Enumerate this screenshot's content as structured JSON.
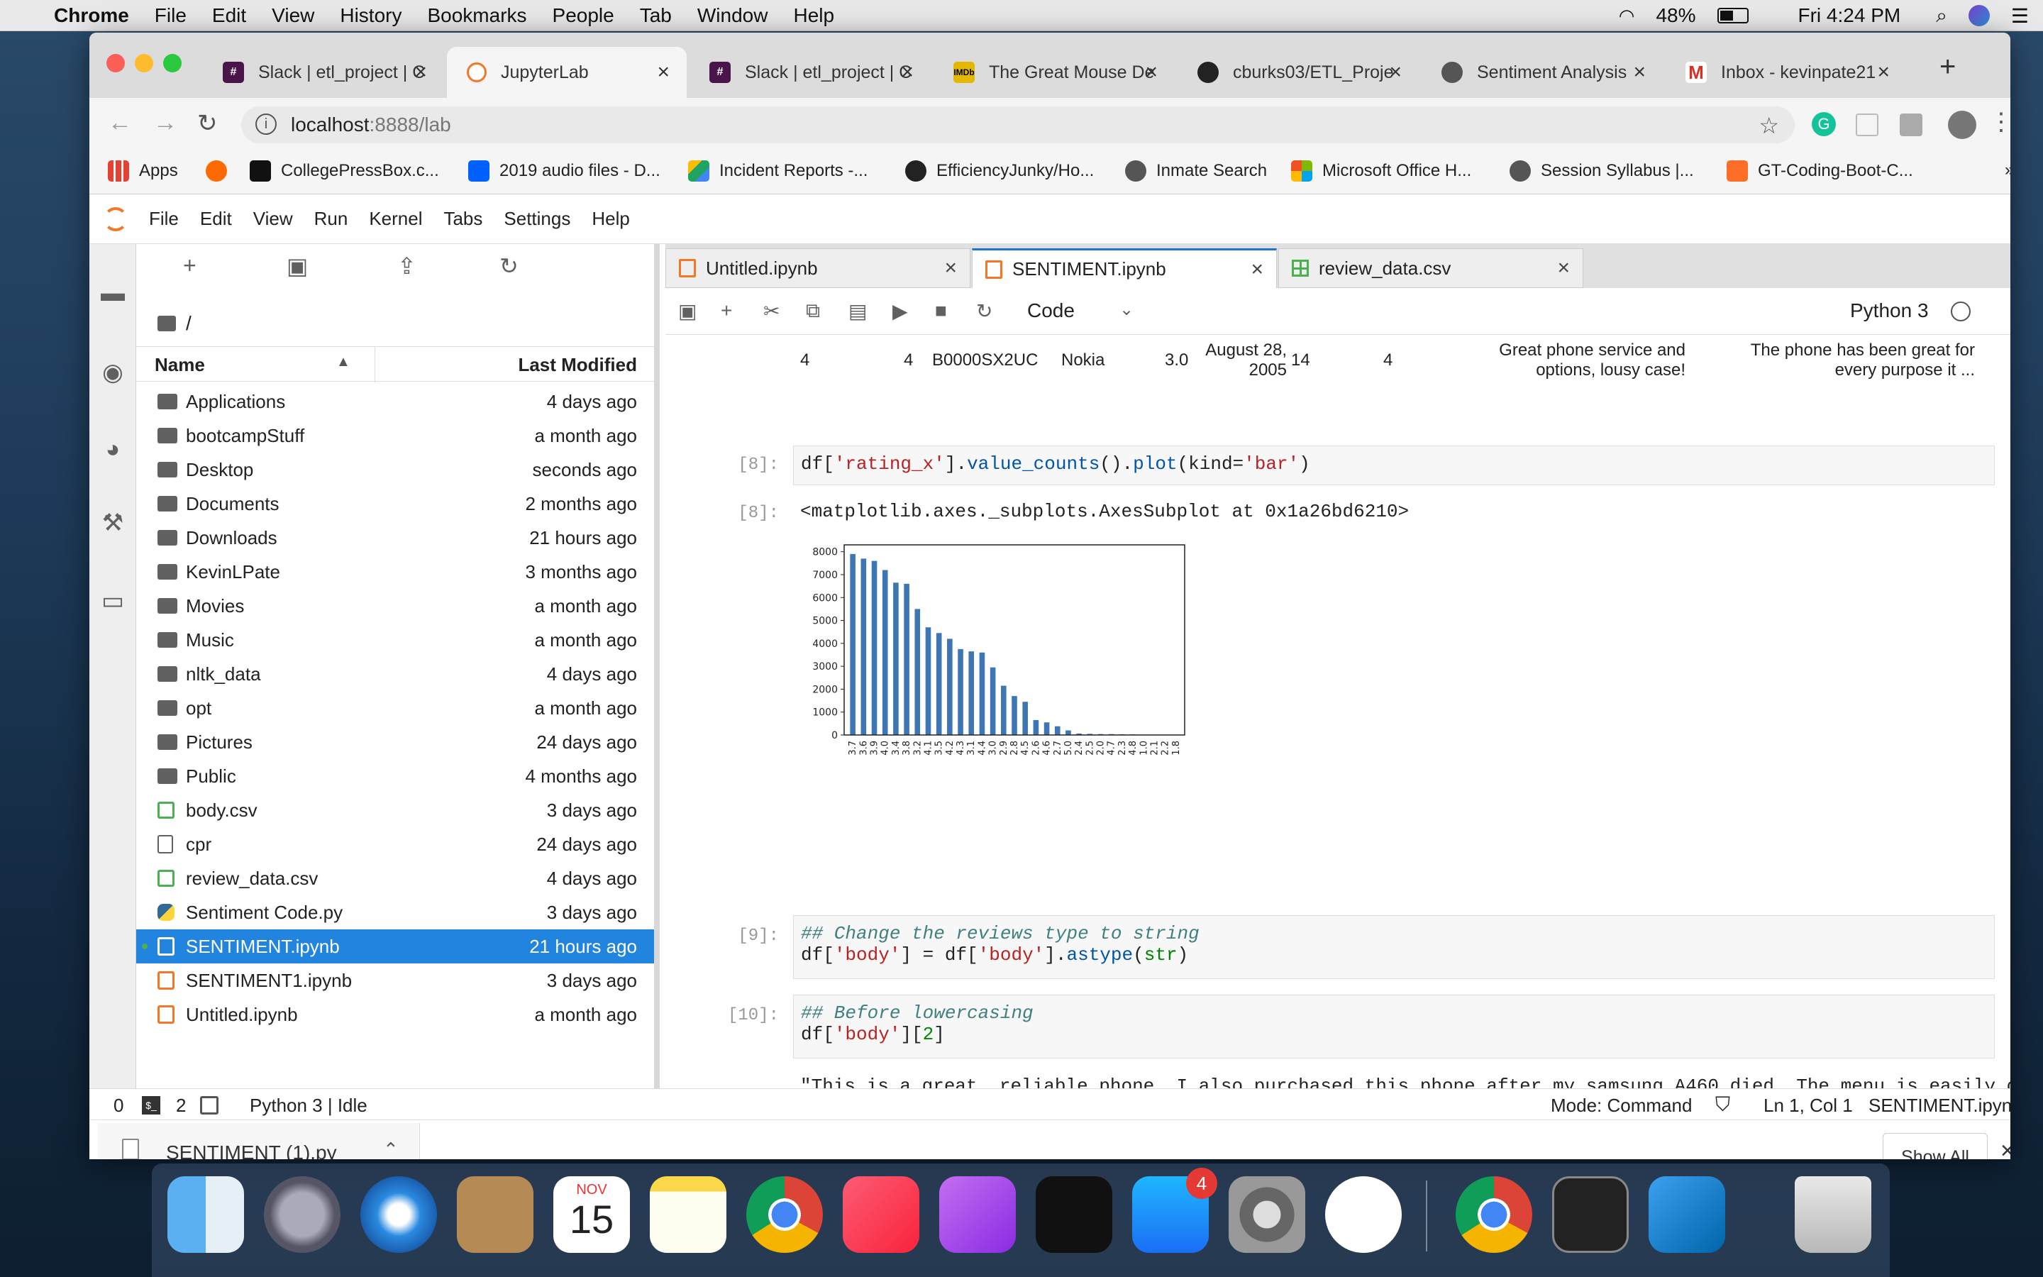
{
  "mac_menubar": {
    "app": "Chrome",
    "items": [
      "File",
      "Edit",
      "View",
      "History",
      "Bookmarks",
      "People",
      "Tab",
      "Window",
      "Help"
    ],
    "battery": "48%",
    "clock": "Fri 4:24 PM"
  },
  "chrome": {
    "tabs": [
      {
        "title": "Slack | etl_project | C",
        "color": "#4a154b",
        "icon": "slack-icon"
      },
      {
        "title": "JupyterLab",
        "color": "#f37726",
        "icon": "jupyter-icon",
        "active": true
      },
      {
        "title": "Slack | etl_project | C",
        "color": "#4a154b",
        "icon": "slack-icon"
      },
      {
        "title": "The Great Mouse De",
        "color": "#e5b800",
        "icon": "imdb-icon"
      },
      {
        "title": "cburks03/ETL_Proje",
        "color": "#222222",
        "icon": "github-icon"
      },
      {
        "title": "Sentiment Analysis",
        "color": "#555555",
        "icon": "globe-icon"
      },
      {
        "title": "Inbox - kevinpate21",
        "color": "#d93025",
        "icon": "gmail-icon"
      }
    ],
    "url_host": "localhost",
    "url_path": ":8888/lab",
    "bookmarks": [
      {
        "label": "Apps",
        "color": "#e34133"
      },
      {
        "label": "",
        "color": "#ff6a00"
      },
      {
        "label": "CollegePressBox.c...",
        "color": "#111111"
      },
      {
        "label": "2019 audio files - D...",
        "color": "#0061fe"
      },
      {
        "label": "Incident Reports -...",
        "color": "#1fa463"
      },
      {
        "label": "EfficiencyJunky/Ho...",
        "color": "#222222"
      },
      {
        "label": "Inmate Search",
        "color": "#555555"
      },
      {
        "label": "Microsoft Office H...",
        "color": "#f25022"
      },
      {
        "label": "Session Syllabus |...",
        "color": "#555555"
      },
      {
        "label": "GT-Coding-Boot-C...",
        "color": "#fc6d26"
      }
    ],
    "more": "»"
  },
  "jupyter": {
    "menu": [
      "File",
      "Edit",
      "View",
      "Run",
      "Kernel",
      "Tabs",
      "Settings",
      "Help"
    ],
    "filebrowser": {
      "path": "/",
      "col_name": "Name",
      "col_modified": "Last Modified",
      "files": [
        {
          "name": "Applications",
          "modified": "4 days ago",
          "type": "folder"
        },
        {
          "name": "bootcampStuff",
          "modified": "a month ago",
          "type": "folder"
        },
        {
          "name": "Desktop",
          "modified": "seconds ago",
          "type": "folder"
        },
        {
          "name": "Documents",
          "modified": "2 months ago",
          "type": "folder"
        },
        {
          "name": "Downloads",
          "modified": "21 hours ago",
          "type": "folder"
        },
        {
          "name": "KevinLPate",
          "modified": "3 months ago",
          "type": "folder"
        },
        {
          "name": "Movies",
          "modified": "a month ago",
          "type": "folder"
        },
        {
          "name": "Music",
          "modified": "a month ago",
          "type": "folder"
        },
        {
          "name": "nltk_data",
          "modified": "4 days ago",
          "type": "folder"
        },
        {
          "name": "opt",
          "modified": "a month ago",
          "type": "folder"
        },
        {
          "name": "Pictures",
          "modified": "24 days ago",
          "type": "folder"
        },
        {
          "name": "Public",
          "modified": "4 months ago",
          "type": "folder"
        },
        {
          "name": "body.csv",
          "modified": "3 days ago",
          "type": "csv"
        },
        {
          "name": "cpr",
          "modified": "24 days ago",
          "type": "file"
        },
        {
          "name": "review_data.csv",
          "modified": "4 days ago",
          "type": "csv"
        },
        {
          "name": "Sentiment Code.py",
          "modified": "3 days ago",
          "type": "py"
        },
        {
          "name": "SENTIMENT.ipynb",
          "modified": "21 hours ago",
          "type": "nb",
          "selected": true
        },
        {
          "name": "SENTIMENT1.ipynb",
          "modified": "3 days ago",
          "type": "nb"
        },
        {
          "name": "Untitled.ipynb",
          "modified": "a month ago",
          "type": "nb"
        }
      ]
    },
    "doctabs": [
      "Untitled.ipynb",
      "SENTIMENT.ipynb",
      "review_data.csv"
    ],
    "toolbar": {
      "cell_type": "Code",
      "kernel": "Python 3"
    },
    "table_row": {
      "idx": "4",
      "col1": "4",
      "asin": "B0000SX2UC",
      "brand": "Nokia",
      "rating": "3.0",
      "c5": "14",
      "c6": "4",
      "date_l1": "August 28,",
      "date_l2": "2005",
      "title_l1": "Great phone service and",
      "title_l2": "options, lousy case!",
      "body_l1": "The phone has been great for",
      "body_l2": "every purpose it ..."
    },
    "cells": {
      "c8_prompt": "[8]:",
      "c8_out_prompt": "[8]:",
      "c8_out": "<matplotlib.axes._subplots.AxesSubplot at 0x1a26bd6210>",
      "c9_prompt": "[9]:",
      "c9_comment": "## Change the reviews type to string",
      "c10_prompt": "[10]:",
      "c10_comment": "## Before lowercasing",
      "c11_out": "\"This is a great, reliable phone. I also purchased this phone after my samsung A460 died. The menu is easily comprehe"
    },
    "statusbar": {
      "n0": "0",
      "n2": "2",
      "kernel_status": "Python 3 | Idle",
      "mode": "Mode: Command",
      "cursor": "Ln 1, Col 1",
      "file": "SENTIMENT.ipynb"
    }
  },
  "download_bar": {
    "file": "SENTIMENT (1).py",
    "show_all": "Show All"
  },
  "dock": {
    "calendar_month": "NOV",
    "calendar_day": "15",
    "appstore_badge": "4"
  },
  "chart_data": {
    "type": "bar",
    "categories": [
      "3.7",
      "3.6",
      "3.9",
      "4.0",
      "3.4",
      "3.8",
      "3.2",
      "4.1",
      "3.5",
      "4.2",
      "4.3",
      "3.1",
      "4.4",
      "3.0",
      "2.9",
      "2.8",
      "4.5",
      "2.6",
      "4.6",
      "2.7",
      "5.0",
      "2.4",
      "2.5",
      "2.0",
      "4.7",
      "2.3",
      "4.8",
      "1.0",
      "2.1",
      "2.2",
      "1.8"
    ],
    "values": [
      7900,
      7700,
      7600,
      7200,
      6650,
      6600,
      5500,
      4700,
      4450,
      4200,
      3750,
      3650,
      3600,
      2950,
      2150,
      1700,
      1450,
      650,
      550,
      380,
      200,
      60,
      50,
      40,
      40,
      30,
      25,
      15,
      10,
      5,
      3
    ],
    "ylim": [
      0,
      8300
    ],
    "yticks": [
      0,
      1000,
      2000,
      3000,
      4000,
      5000,
      6000,
      7000,
      8000
    ]
  }
}
